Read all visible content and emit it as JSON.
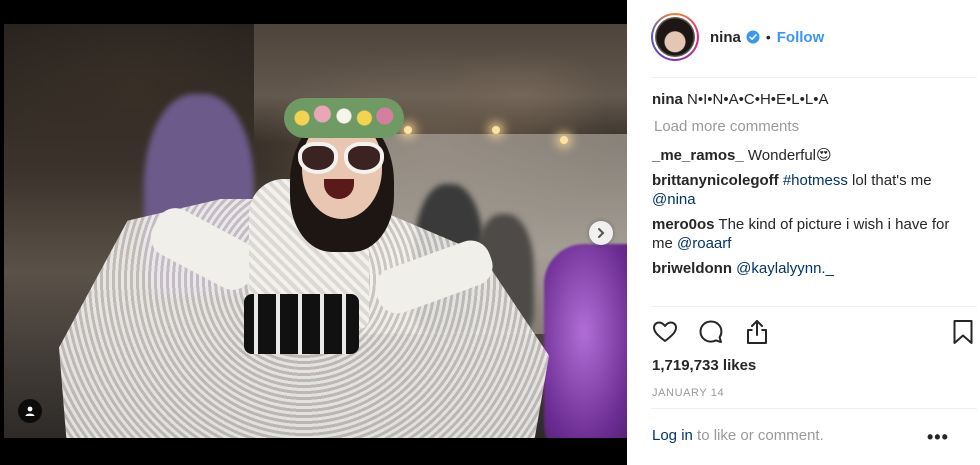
{
  "post": {
    "username": "nina",
    "follow_label": "Follow",
    "separator": "•",
    "caption": {
      "username": "nina",
      "text": "N•I•N•A•C•H•E•L•L•A"
    },
    "load_more_label": "Load more comments",
    "comments": [
      {
        "username": "_me_ramos_",
        "text": "Wonderful😍",
        "mention": "",
        "hashtag": "",
        "tail": ""
      },
      {
        "username": "brittanynicolegoff",
        "hashtag": "#hotmess",
        "text": " lol that's me ",
        "mention": "@nina",
        "tail": ""
      },
      {
        "username": "mero0os",
        "text": " The kind of picture i wish i have for me ",
        "mention": "@roaarf",
        "hashtag": "",
        "tail": ""
      },
      {
        "username": "briweldonn",
        "text": " ",
        "mention": "@kaylalyynn._",
        "hashtag": "",
        "tail": ""
      }
    ],
    "likes": "1,719,733 likes",
    "date": "JANUARY 14",
    "login_link": "Log in",
    "login_text": " to like or comment.",
    "more_label": "•••"
  },
  "icons": {
    "verified": "verified-badge-icon",
    "like": "heart-icon",
    "comment": "comment-icon",
    "share": "share-icon",
    "save": "bookmark-icon",
    "next": "chevron-right-icon",
    "tag": "user-tag-icon"
  },
  "colors": {
    "link": "#003569",
    "follow": "#3897f0",
    "muted": "#999999"
  }
}
